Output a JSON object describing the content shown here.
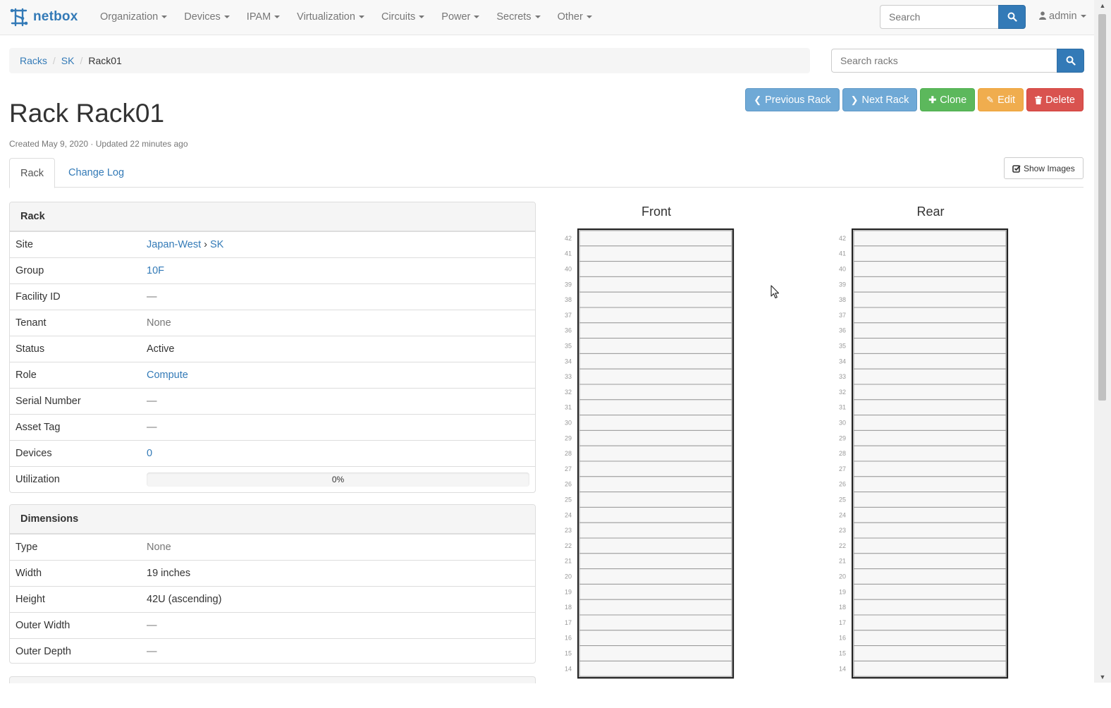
{
  "navbar": {
    "brand": "netbox",
    "menus": [
      "Organization",
      "Devices",
      "IPAM",
      "Virtualization",
      "Circuits",
      "Power",
      "Secrets",
      "Other"
    ],
    "search_placeholder": "Search",
    "user": "admin"
  },
  "breadcrumb": [
    "Racks",
    "SK",
    "Rack01"
  ],
  "rack_search_placeholder": "Search racks",
  "actions": {
    "previous": "Previous Rack",
    "next": "Next Rack",
    "clone": "Clone",
    "edit": "Edit",
    "delete": "Delete"
  },
  "title": "Rack Rack01",
  "meta": "Created May 9, 2020 · Updated 22 minutes ago",
  "tabs": [
    "Rack",
    "Change Log"
  ],
  "show_images": "Show Images",
  "rack_panel": {
    "heading": "Rack",
    "site_region": "Japan-West",
    "site_sep": "›",
    "site_name": "SK",
    "rows": [
      {
        "label": "Site"
      },
      {
        "label": "Group",
        "value": "10F"
      },
      {
        "label": "Facility ID",
        "value": "—"
      },
      {
        "label": "Tenant",
        "value": "None"
      },
      {
        "label": "Status",
        "value": "Active"
      },
      {
        "label": "Role",
        "value": "Compute"
      },
      {
        "label": "Serial Number",
        "value": "—"
      },
      {
        "label": "Asset Tag",
        "value": "—"
      },
      {
        "label": "Devices",
        "value": "0"
      },
      {
        "label": "Utilization",
        "value": "0%"
      }
    ],
    "utilization": 0
  },
  "dimensions_panel": {
    "heading": "Dimensions",
    "rows": [
      {
        "label": "Type",
        "value": "None"
      },
      {
        "label": "Width",
        "value": "19 inches"
      },
      {
        "label": "Height",
        "value": "42U (ascending)"
      },
      {
        "label": "Outer Width",
        "value": "—"
      },
      {
        "label": "Outer Depth",
        "value": "—"
      }
    ]
  },
  "elevations": {
    "front_title": "Front",
    "rear_title": "Rear",
    "units": [
      42,
      41,
      40,
      39,
      38,
      37,
      36,
      35,
      34,
      33,
      32,
      31,
      30,
      29,
      28,
      27,
      26,
      25,
      24,
      23,
      22,
      21,
      20,
      19,
      18,
      17,
      16,
      15,
      14
    ]
  }
}
